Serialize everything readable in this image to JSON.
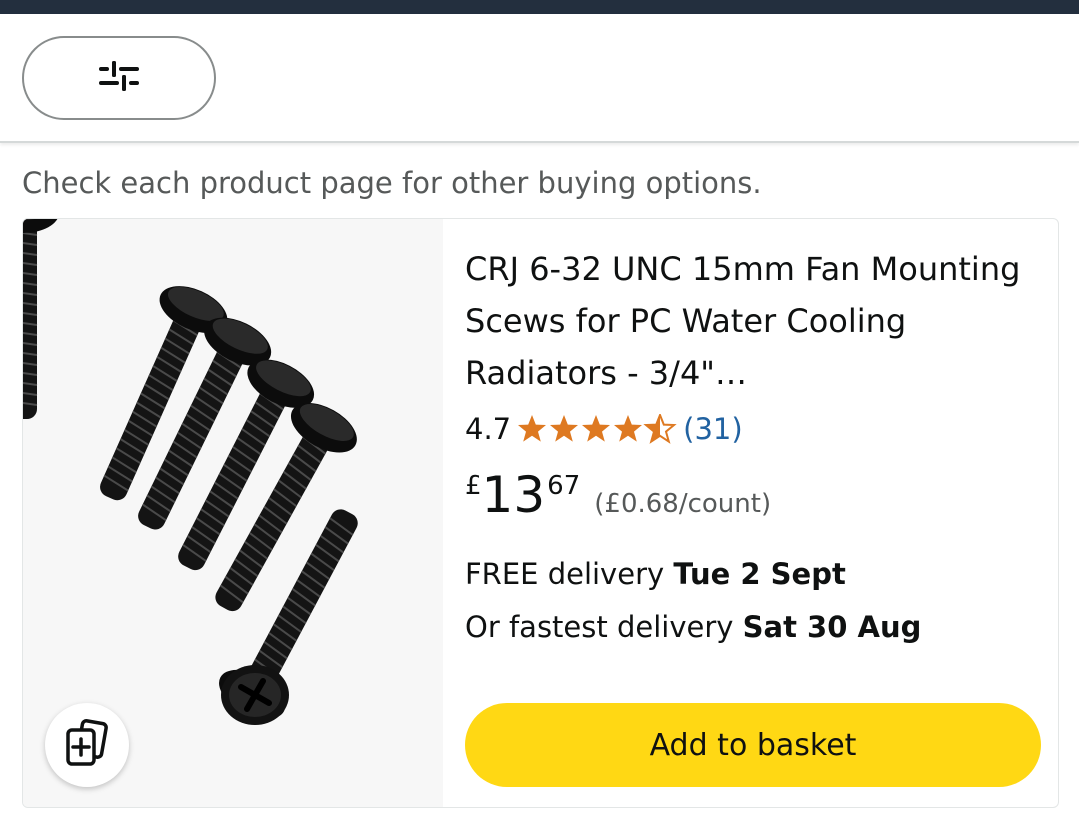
{
  "header": {
    "filter_icon": "sliders-icon"
  },
  "notice": "Check each product page for other buying options.",
  "product": {
    "image_alt": "Black fan mounting screws",
    "compare_icon": "add-to-compare-icon",
    "title": "CRJ 6-32 UNC 15mm Fan Mounting Scews for PC Water Cooling Radiators - 3/4\"…",
    "rating": {
      "score": "4.7",
      "stars": 4.5,
      "count": "(31)"
    },
    "price": {
      "symbol": "£",
      "whole": "13",
      "fraction": "67",
      "per_unit": "(£0.68/count)"
    },
    "delivery": {
      "label": "FREE delivery ",
      "date": "Tue 2 Sept"
    },
    "fastest": {
      "label": "Or fastest delivery ",
      "date": "Sat 30 Aug"
    },
    "add_button": "Add to basket"
  },
  "colors": {
    "header_strip": "#232f3e",
    "star": "#de7921",
    "add_button": "#ffd814",
    "link": "#2162a1"
  }
}
